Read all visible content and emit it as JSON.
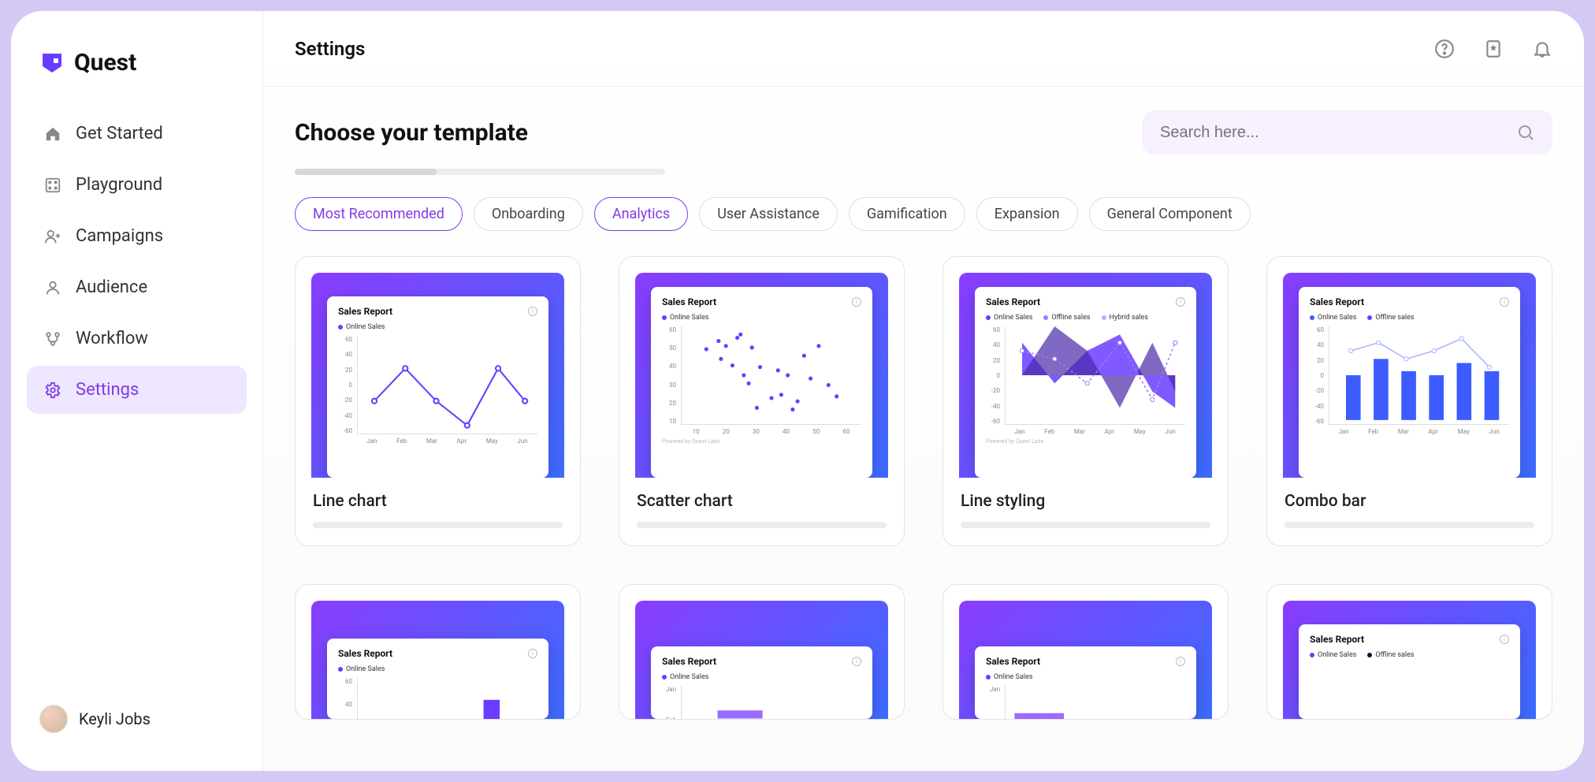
{
  "brand": {
    "name": "Quest"
  },
  "sidebar": {
    "items": [
      {
        "label": "Get Started",
        "active": false
      },
      {
        "label": "Playground",
        "active": false
      },
      {
        "label": "Campaigns",
        "active": false
      },
      {
        "label": "Audience",
        "active": false
      },
      {
        "label": "Workflow",
        "active": false
      },
      {
        "label": "Settings",
        "active": true
      }
    ]
  },
  "user": {
    "name": "Keyli Jobs"
  },
  "header": {
    "title": "Settings"
  },
  "page": {
    "title": "Choose your template",
    "search_placeholder": "Search here..."
  },
  "filters": [
    "Most Recommended",
    "Onboarding",
    "Analytics",
    "User Assistance",
    "Gamification",
    "Expansion",
    "General Component"
  ],
  "templates": [
    {
      "label": "Line chart"
    },
    {
      "label": "Scatter chart"
    },
    {
      "label": "Line styling"
    },
    {
      "label": "Combo bar"
    }
  ],
  "colors": {
    "accent": "#7f3ce8",
    "blue": "#3c5cff"
  },
  "chart_preview": {
    "title": "Sales Report",
    "powered": "Powered by Quest Labs",
    "legends": {
      "online": "Online Sales",
      "offline": "Offline sales",
      "hybrid": "Hybrid sales"
    },
    "months": [
      "Jan",
      "Feb",
      "Mar",
      "Apr",
      "May",
      "Jun"
    ],
    "yticks_neg": [
      "60",
      "40",
      "20",
      "0",
      "-20",
      "-40",
      "-60"
    ],
    "scatter_xticks": [
      "10",
      "20",
      "30",
      "40",
      "50",
      "60"
    ],
    "scatter_yticks": [
      "60",
      "50",
      "40",
      "30",
      "20",
      "10"
    ]
  },
  "chart_data": [
    {
      "type": "line",
      "title": "Sales Report",
      "categories": [
        "Jan",
        "Feb",
        "Mar",
        "Apr",
        "May",
        "Jun"
      ],
      "series": [
        {
          "name": "Online Sales",
          "values": [
            -20,
            20,
            -20,
            -50,
            20,
            -20
          ]
        }
      ],
      "ylim": [
        -60,
        60
      ]
    },
    {
      "type": "scatter",
      "title": "Sales Report",
      "xlim": [
        10,
        60
      ],
      "ylim": [
        10,
        60
      ],
      "points": [
        [
          12,
          48
        ],
        [
          19,
          54
        ],
        [
          20,
          43
        ],
        [
          22,
          51
        ],
        [
          25,
          39
        ],
        [
          27,
          55
        ],
        [
          29,
          58
        ],
        [
          30,
          32
        ],
        [
          32,
          28
        ],
        [
          33,
          49
        ],
        [
          35,
          15
        ],
        [
          36,
          38
        ],
        [
          40,
          20
        ],
        [
          42,
          36
        ],
        [
          43,
          22
        ],
        [
          45,
          33
        ],
        [
          47,
          14
        ],
        [
          48,
          18
        ],
        [
          50,
          45
        ],
        [
          52,
          30
        ],
        [
          55,
          50
        ],
        [
          58,
          28
        ],
        [
          60,
          22
        ]
      ]
    },
    {
      "type": "area",
      "title": "Sales Report",
      "categories": [
        "Jan",
        "Feb",
        "Mar",
        "Apr",
        "May",
        "Jun"
      ],
      "series": [
        {
          "name": "Online Sales",
          "values": [
            40,
            -10,
            30,
            50,
            -20,
            -40
          ]
        },
        {
          "name": "Offline sales",
          "values": [
            0,
            60,
            30,
            -40,
            40,
            -20
          ]
        },
        {
          "name": "Hybrid sales",
          "values": [
            30,
            20,
            -10,
            40,
            -30,
            40
          ]
        }
      ],
      "ylim": [
        -60,
        60
      ]
    },
    {
      "type": "bar",
      "title": "Sales Report",
      "categories": [
        "Jan",
        "Feb",
        "Mar",
        "Apr",
        "May",
        "Jun"
      ],
      "series": [
        {
          "name": "Online Sales",
          "values": [
            -40,
            -20,
            0,
            -40,
            -20,
            -30
          ]
        },
        {
          "name": "Offline sales",
          "values": [
            10,
            40,
            20,
            10,
            30,
            20
          ]
        }
      ],
      "line_overlay": [
        30,
        40,
        20,
        30,
        45,
        10
      ],
      "ylim": [
        -60,
        60
      ]
    }
  ]
}
